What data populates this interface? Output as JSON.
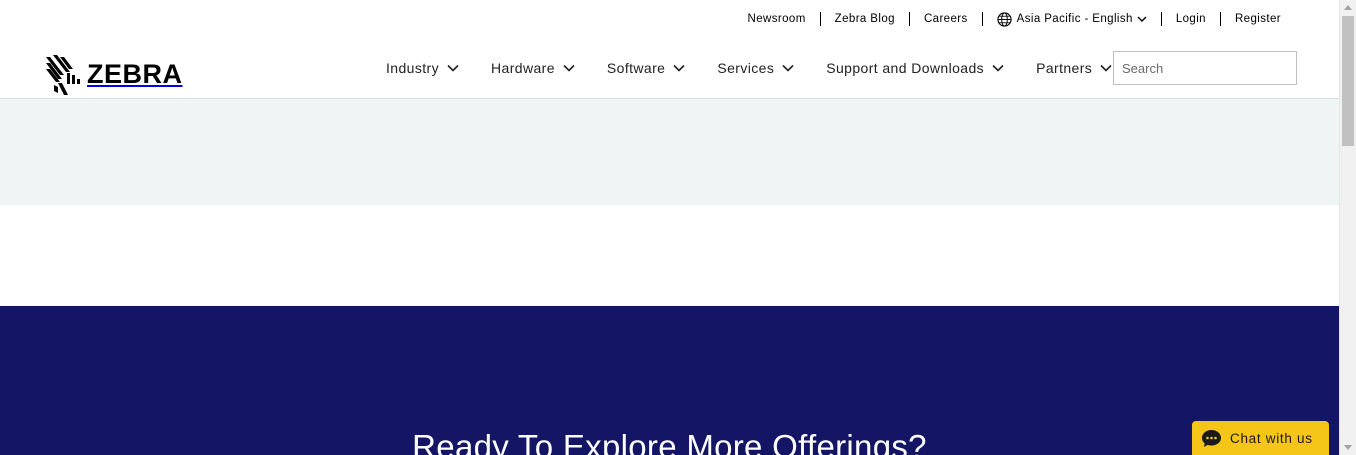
{
  "utility_nav": {
    "newsroom": "Newsroom",
    "blog": "Zebra Blog",
    "careers": "Careers",
    "region": "Asia Pacific - English",
    "login": "Login",
    "register": "Register"
  },
  "brand": {
    "name": "ZEBRA"
  },
  "main_nav": {
    "industry": "Industry",
    "hardware": "Hardware",
    "software": "Software",
    "services": "Services",
    "support": "Support and Downloads",
    "partners": "Partners"
  },
  "search": {
    "placeholder": "Search",
    "value": ""
  },
  "cta": {
    "heading": "Ready To Explore More Offerings?"
  },
  "chat": {
    "label": "Chat with us"
  },
  "colors": {
    "navy": "#151565",
    "light_band": "#eff4f5",
    "chat_yellow": "#f5c518"
  },
  "icons": [
    "globe-icon",
    "chevron-down-icon",
    "search-icon",
    "chat-bubble-icon",
    "zebra-logo-icon"
  ]
}
